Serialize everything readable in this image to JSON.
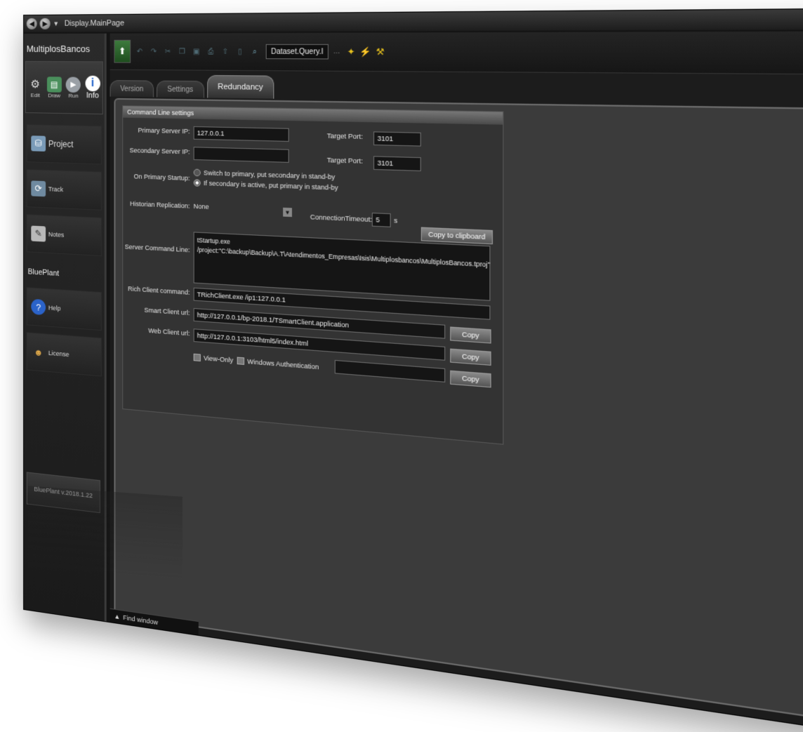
{
  "window": {
    "title": "Display.MainPage"
  },
  "sidebar": {
    "app_name": "MultiplosBancos",
    "tools": [
      {
        "label": "Edit",
        "icon": "gear-icon"
      },
      {
        "label": "Draw",
        "icon": "draw-icon"
      },
      {
        "label": "Run",
        "icon": "play-icon"
      },
      {
        "label": "Info",
        "icon": "info-icon"
      }
    ],
    "project_label": "Project",
    "track_label": "Track",
    "notes_label": "Notes",
    "blueplant_heading": "BluePlant",
    "help_label": "Help",
    "license_label": "License",
    "version": "BluePlant v.2018.1.22"
  },
  "toolbar": {
    "query_combo": "Dataset.Query.I"
  },
  "tabs": [
    {
      "label": "Version"
    },
    {
      "label": "Settings"
    },
    {
      "label": "Redundancy"
    }
  ],
  "panel": {
    "header": "Command Line settings",
    "primary_ip_label": "Primary Server IP:",
    "primary_ip_value": "127.0.0.1",
    "secondary_ip_label": "Secondary Server IP:",
    "secondary_ip_value": "",
    "target_port_label": "Target Port:",
    "target_port_1": "3101",
    "target_port_2": "3101",
    "startup_label": "On Primary Startup:",
    "startup_option_1": "Switch to primary, put secondary in stand-by",
    "startup_option_2": "If secondary is active, put primary in stand-by",
    "historian_label": "Historian Replication:",
    "historian_value": "None",
    "timeout_label": "ConnectionTimeout:",
    "timeout_value": "5",
    "timeout_unit": "s",
    "copy_clipboard_label": "Copy to clipboard",
    "server_cmd_label": "Server Command Line:",
    "server_cmd_value": "tStartup.exe /project:\"C:\\backup\\Backup\\A.T\\Atendimentos_Empresas\\Isis\\Multiplosbancos\\MultiplosBancos.tproj\"",
    "rich_label": "Rich Client command:",
    "rich_value": "TRichClient.exe /ip1:127.0.0.1",
    "smart_label": "Smart Client url:",
    "smart_value": "http://127.0.0.1/bp-2018.1/TSmartClient.application",
    "web_label": "Web Client url:",
    "web_value": "http://127.0.0.1:3103/html5/index.html",
    "copy_label": "Copy",
    "view_only_label": "View-Only",
    "windows_auth_label": "Windows Authentication",
    "windows_auth_value": ""
  },
  "footer": {
    "find_window": "Find window"
  }
}
